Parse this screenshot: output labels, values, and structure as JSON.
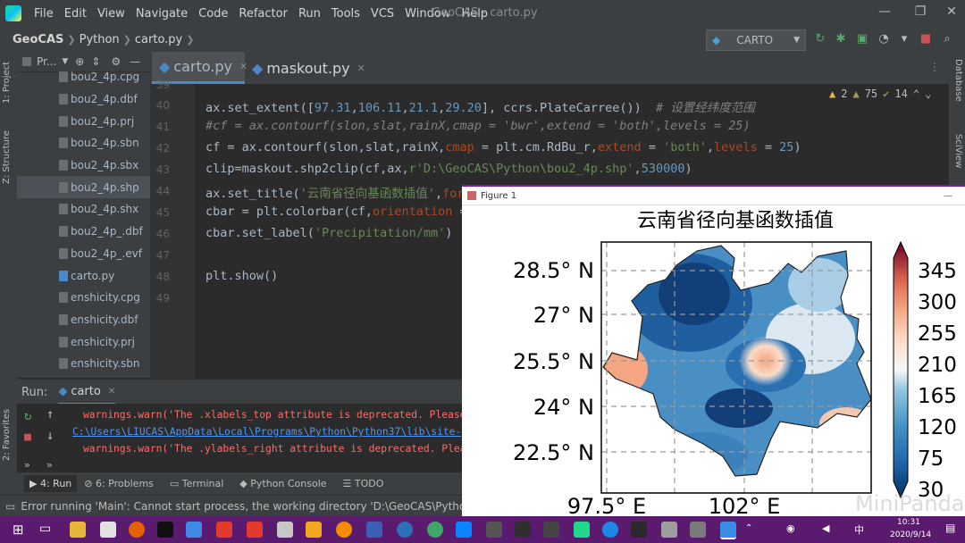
{
  "menubar": {
    "items": [
      "File",
      "Edit",
      "View",
      "Navigate",
      "Code",
      "Refactor",
      "Run",
      "Tools",
      "VCS",
      "Window",
      "Help"
    ],
    "window_title": "GeoCAS - carto.py"
  },
  "breadcrumb": {
    "project": "GeoCAS",
    "folder": "Python",
    "file": "carto.py"
  },
  "run_config": {
    "name": "CARTO"
  },
  "sidebar_tabs": {
    "project": "1: Project",
    "structure": "Z: Structure",
    "favorites": "2: Favorites",
    "database": "Database",
    "sciview": "SciView"
  },
  "project_panel": {
    "title": "Pr...",
    "files": [
      "bou2_4p.cpg",
      "bou2_4p.dbf",
      "bou2_4p.prj",
      "bou2_4p.sbn",
      "bou2_4p.sbx",
      "bou2_4p.shp",
      "bou2_4p.shx",
      "bou2_4p_.dbf",
      "bou2_4p_.evf",
      "carto.py",
      "enshicity.cpg",
      "enshicity.dbf",
      "enshicity.prj",
      "enshicity.sbn"
    ],
    "selected": "bou2_4p.shp"
  },
  "editor": {
    "tabs": [
      {
        "label": "carto.py",
        "active": true
      },
      {
        "label": "maskout.py",
        "active": false
      }
    ],
    "inspections": {
      "warnings": "2",
      "weak": "75",
      "ok": "14"
    },
    "first_line": "39",
    "line_numbers": [
      "40",
      "41",
      "42",
      "43",
      "44",
      "45",
      "46",
      "47",
      "48",
      "49"
    ]
  },
  "run": {
    "label": "Run:",
    "tab": "carto",
    "lines": [
      "warnings.warn('The .xlabels_top attribute is deprecated. Please '",
      "C:\\Users\\LIUCAS\\AppData\\Local\\Programs\\Python\\Python37\\lib\\site-packag",
      "warnings.warn('The .ylabels_right attribute is deprecated. Please '"
    ]
  },
  "bottom_tabs": [
    "4: Run",
    "6: Problems",
    "Terminal",
    "Python Console",
    "TODO"
  ],
  "status_text": "Error running 'Main': Cannot start process, the working directory 'D:\\GeoCAS\\Python\\Python",
  "taskbar": {
    "time": "10:31",
    "date": "2020/9/14",
    "lang": "中"
  },
  "figure": {
    "window_title": "Figure 1"
  },
  "watermark": "MiniPanda",
  "colors": {
    "accent": "#7a1fa2",
    "editor_bg": "#2b2b2b",
    "panel_bg": "#3c3f41"
  },
  "chart_data": {
    "type": "heatmap",
    "title": "云南省径向基函数插值",
    "y_ticks": [
      "28.5° N",
      "27° N",
      "25.5° N",
      "24° N",
      "22.5° N"
    ],
    "x_ticks": [
      "97.5° E",
      "102° E"
    ],
    "colorbar_ticks": [
      "345",
      "300",
      "255",
      "210",
      "165",
      "120",
      "75",
      "30"
    ],
    "colorbar_range": [
      30,
      345
    ],
    "colormap": "RdBu_r",
    "grid": true
  }
}
